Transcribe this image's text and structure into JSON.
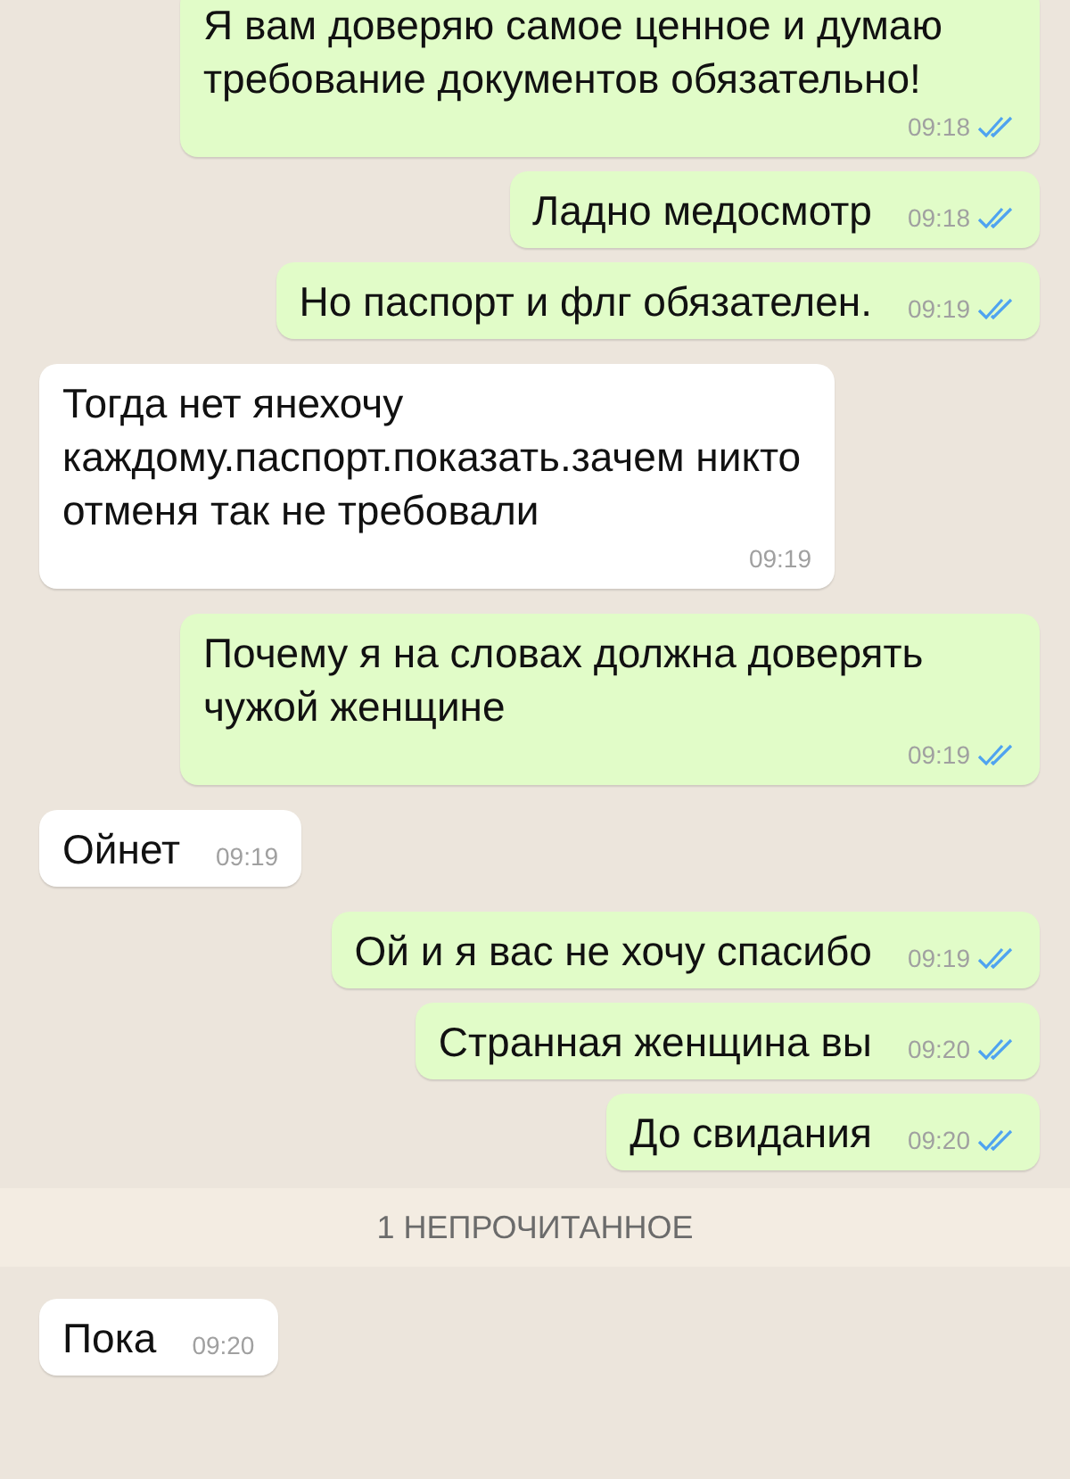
{
  "messages": [
    {
      "kind": "outgoing",
      "text": "Я вам доверяю самое ценное и думаю требование документов обязательно!",
      "time": "09:18",
      "read": true
    },
    {
      "kind": "outgoing",
      "text": "Ладно медосмотр",
      "time": "09:18",
      "read": true
    },
    {
      "kind": "outgoing",
      "text": "Но паспорт и флг обязателен.",
      "time": "09:19",
      "read": true
    },
    {
      "kind": "incoming",
      "text": "Тогда нет янехочу каждому.паспорт.показать.зачем никто отменя так не требовали",
      "time": "09:19"
    },
    {
      "kind": "outgoing",
      "text": "Почему я на словах должна доверять чужой женщине",
      "time": "09:19",
      "read": true
    },
    {
      "kind": "incoming",
      "text": "Ойнет",
      "time": "09:19"
    },
    {
      "kind": "outgoing",
      "text": "Ой и я вас не хочу спасибо",
      "time": "09:19",
      "read": true
    },
    {
      "kind": "outgoing",
      "text": "Странная женщина вы",
      "time": "09:20",
      "read": true
    },
    {
      "kind": "outgoing",
      "text": "До свидания",
      "time": "09:20",
      "read": true
    },
    {
      "kind": "divider",
      "text": "1 НЕПРОЧИТАННОЕ"
    },
    {
      "kind": "incoming",
      "text": "Пока",
      "time": "09:20"
    }
  ]
}
